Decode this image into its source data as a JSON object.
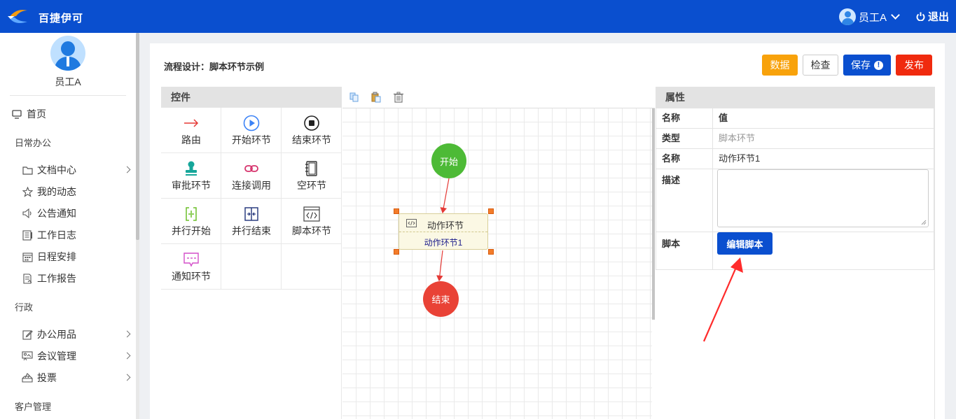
{
  "app": {
    "name": "百捷伊可"
  },
  "header": {
    "user_name": "员工A",
    "logout_label": "退出"
  },
  "sidebar": {
    "user_name": "员工A",
    "home": "首页",
    "groups": [
      {
        "title": "日常办公",
        "items": [
          "文档中心",
          "我的动态",
          "公告通知",
          "工作日志",
          "日程安排",
          "工作报告"
        ]
      },
      {
        "title": "行政",
        "items": [
          "办公用品",
          "会议管理",
          "投票"
        ]
      },
      {
        "title": "客户管理",
        "items": []
      }
    ]
  },
  "page": {
    "title": "流程设计：脚本环节示例"
  },
  "toolbar": {
    "data_label": "数据",
    "check_label": "检查",
    "save_label": "保存",
    "publish_label": "发布"
  },
  "controls": {
    "header": "控件",
    "items": [
      "路由",
      "开始环节",
      "结束环节",
      "审批环节",
      "连接调用",
      "空环节",
      "并行开始",
      "并行结束",
      "脚本环节",
      "通知环节"
    ]
  },
  "canvas": {
    "start_label": "开始",
    "end_label": "结束",
    "action_node": {
      "type_label": "动作环节",
      "name": "动作环节1"
    }
  },
  "properties": {
    "header": "属性",
    "col_name": "名称",
    "col_value": "值",
    "rows": [
      {
        "key": "类型",
        "value": "脚本环节"
      },
      {
        "key": "名称",
        "value": "动作环节1"
      },
      {
        "key": "描述",
        "value": ""
      },
      {
        "key": "脚本",
        "value": ""
      }
    ],
    "edit_script_label": "编辑脚本"
  },
  "colors": {
    "brand": "#0a4fcf",
    "warning": "#f8a20b",
    "danger": "#f02a0e",
    "start": "#4dba36",
    "end": "#e94236"
  }
}
